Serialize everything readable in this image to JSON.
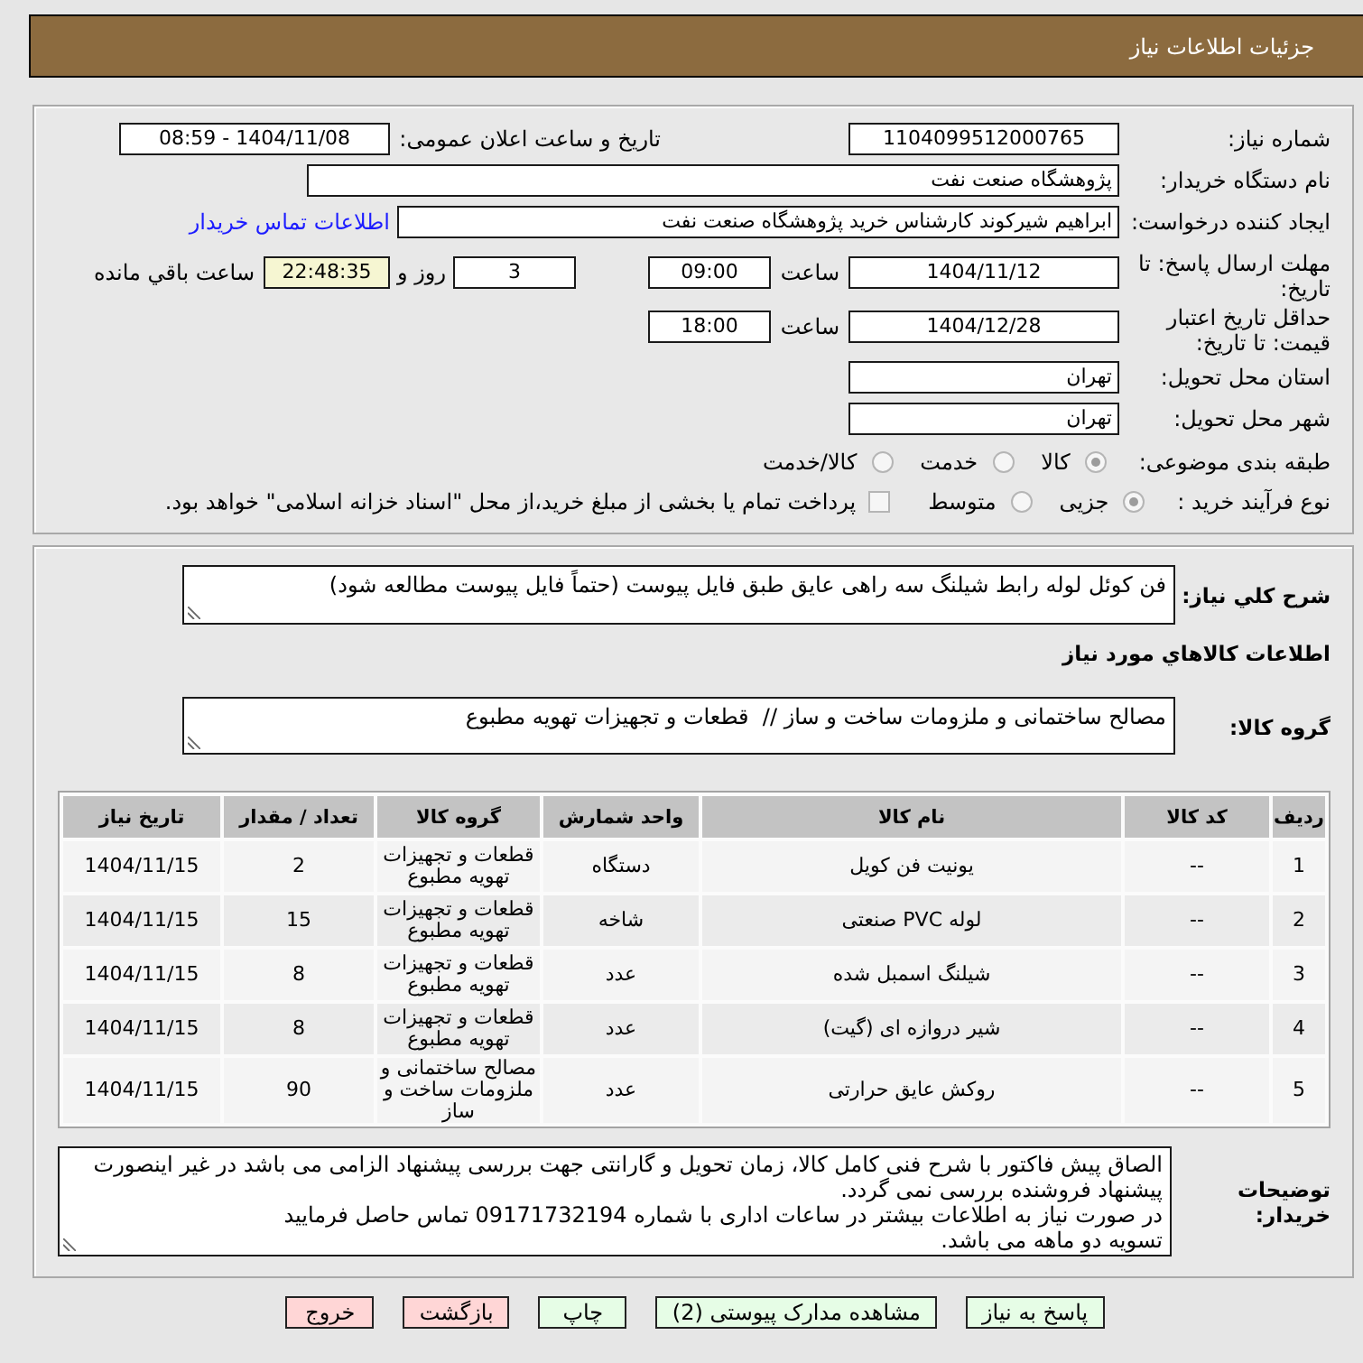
{
  "header": {
    "title": "جزئیات اطلاعات نیاز"
  },
  "details": {
    "need_number": {
      "label": "شماره نیاز:",
      "value": "1104099512000765"
    },
    "announce_date": {
      "label": "تاریخ و ساعت اعلان عمومی:",
      "value": "1404/11/08 - 08:59"
    },
    "buyer_org": {
      "label": "نام دستگاه خریدار:",
      "value": "پژوهشگاه صنعت نفت"
    },
    "requester": {
      "label": "ایجاد کننده درخواست:",
      "value": "ابراهیم شیرکوند کارشناس خرید پژوهشگاه صنعت نفت",
      "contact_link": "اطلاعات تماس خریدار"
    },
    "response_deadline": {
      "label": "مهلت ارسال پاسخ: تا تاریخ:",
      "date": "1404/11/12",
      "time_label": "ساعت",
      "time": "09:00",
      "days": "3",
      "days_label": "روز و",
      "remaining": "22:48:35",
      "remaining_label": "ساعت باقي مانده"
    },
    "price_validity": {
      "label": "حداقل تاریخ اعتبار قیمت: تا تاریخ:",
      "date": "1404/12/28",
      "time_label": "ساعت",
      "time": "18:00"
    },
    "delivery_province": {
      "label": "استان محل تحویل:",
      "value": "تهران"
    },
    "delivery_city": {
      "label": "شهر محل تحویل:",
      "value": "تهران"
    },
    "category": {
      "label": "طبقه بندی موضوعی:",
      "options": [
        {
          "label": "کالا",
          "selected": true
        },
        {
          "label": "خدمت",
          "selected": false
        },
        {
          "label": "کالا/خدمت",
          "selected": false
        }
      ]
    },
    "purchase_type": {
      "label": "نوع فرآیند خرید :",
      "options": [
        {
          "label": "جزیی",
          "selected": true
        },
        {
          "label": "متوسط",
          "selected": false
        }
      ],
      "treasury_checkbox": {
        "label": "پرداخت تمام یا بخشی از مبلغ خرید،از محل \"اسناد خزانه اسلامی\" خواهد بود.",
        "checked": false
      }
    }
  },
  "description": {
    "label": "شرح کلي نياز:",
    "value": "فن کوئل لوله رابط شیلنگ سه راهی عایق طبق فایل پیوست (حتماً فایل پیوست مطالعه شود)"
  },
  "goods": {
    "title": "اطلاعات کالاهاي مورد نياز",
    "group": {
      "label": "گروه کالا:",
      "value": "مصالح ساختمانی و ملزومات ساخت و ساز //  قطعات و تجهیزات تهویه مطبوع"
    },
    "table": {
      "columns": [
        "ردیف",
        "کد کالا",
        "نام کالا",
        "واحد شمارش",
        "گروه کالا",
        "تعداد / مقدار",
        "تاریخ نیاز"
      ],
      "rows": [
        [
          "1",
          "--",
          "یونیت فن کویل",
          "دستگاه",
          "قطعات و تجهیزات تهویه مطبوع",
          "2",
          "1404/11/15"
        ],
        [
          "2",
          "--",
          "لوله PVC صنعتی",
          "شاخه",
          "قطعات و تجهیزات تهویه مطبوع",
          "15",
          "1404/11/15"
        ],
        [
          "3",
          "--",
          "شیلنگ اسمبل شده",
          "عدد",
          "قطعات و تجهیزات تهویه مطبوع",
          "8",
          "1404/11/15"
        ],
        [
          "4",
          "--",
          "شیر دروازه ای (گیت)",
          "عدد",
          "قطعات و تجهیزات تهویه مطبوع",
          "8",
          "1404/11/15"
        ],
        [
          "5",
          "--",
          "روکش عایق حرارتی",
          "عدد",
          "مصالح ساختمانی و ملزومات ساخت و ساز",
          "90",
          "1404/11/15"
        ]
      ]
    }
  },
  "buyer_notes": {
    "label": "توضیحات خریدار:",
    "value": "الصاق پیش فاکتور با شرح فنی کامل کالا، زمان تحویل و گارانتی جهت بررسی پیشنهاد الزامی می باشد در غیر اینصورت پیشنهاد فروشنده بررسی نمی گردد.\nدر صورت نیاز به اطلاعات بیشتر در ساعات اداری با شماره 09171732194 تماس حاصل فرمایید\nتسویه دو ماهه می باشد."
  },
  "buttons": [
    {
      "label": "پاسخ به نیاز",
      "kind": "primary"
    },
    {
      "label": "مشاهده مدارک پیوستی (2)",
      "kind": "primary"
    },
    {
      "label": "چاپ",
      "kind": "primary"
    },
    {
      "label": "بازگشت",
      "kind": "danger"
    },
    {
      "label": "خروج",
      "kind": "danger"
    }
  ]
}
